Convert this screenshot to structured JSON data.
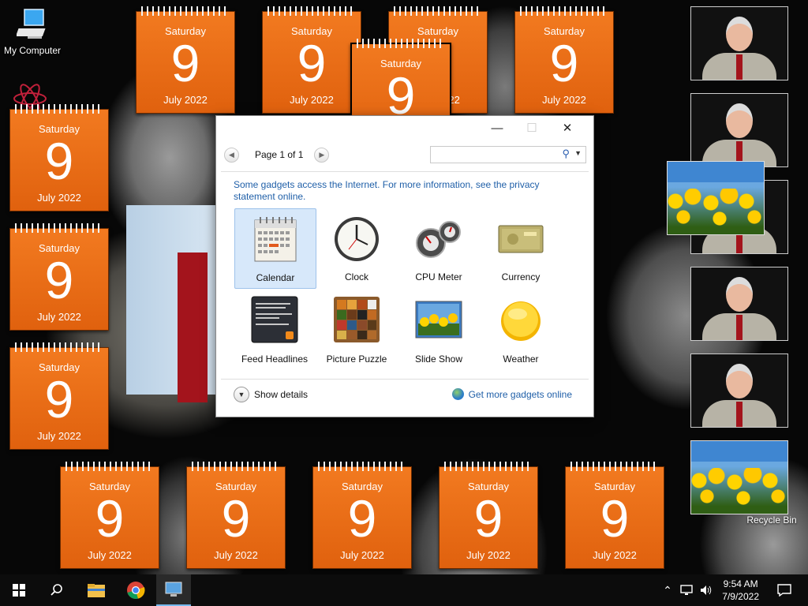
{
  "desktop": {
    "icons": [
      {
        "label": "My Computer"
      },
      {
        "label": "Recycle Bin"
      }
    ],
    "calendar_gadget": {
      "weekday": "Saturday",
      "day": "9",
      "month_year": "July 2022"
    }
  },
  "gadgets_window": {
    "caption": {
      "minimize": "—",
      "maximize": "☐",
      "close": "✕"
    },
    "pager": {
      "label": "Page 1 of 1",
      "prev": "◀",
      "next": "▶"
    },
    "search": {
      "value": "",
      "icon": "search-icon"
    },
    "info_text": "Some gadgets access the Internet.  For more information, see the privacy statement online.",
    "gadgets": [
      {
        "label": "Calendar",
        "icon": "calendar-icon",
        "selected": true
      },
      {
        "label": "Clock",
        "icon": "clock-icon"
      },
      {
        "label": "CPU Meter",
        "icon": "cpu-meter-icon"
      },
      {
        "label": "Currency",
        "icon": "currency-icon"
      },
      {
        "label": "Feed Headlines",
        "icon": "feed-headlines-icon"
      },
      {
        "label": "Picture Puzzle",
        "icon": "picture-puzzle-icon"
      },
      {
        "label": "Slide Show",
        "icon": "slide-show-icon"
      },
      {
        "label": "Weather",
        "icon": "weather-icon"
      }
    ],
    "show_details": "Show details",
    "get_more": "Get more gadgets online"
  },
  "taskbar": {
    "time": "9:54 AM",
    "date": "7/9/2022",
    "pinned": [
      "start-icon",
      "search-icon",
      "file-explorer-icon",
      "chrome-icon",
      "gadgets-app-icon"
    ]
  },
  "colors": {
    "calendar_orange": "#f27a20",
    "link_blue": "#1f5fa8",
    "selection": "#d7e8fa"
  }
}
